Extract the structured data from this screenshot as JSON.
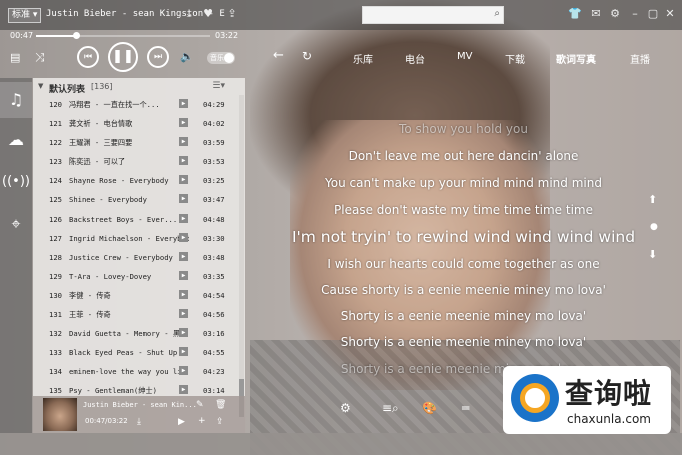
{
  "topbar": {
    "sound_quality": "标准",
    "track_title": "Justin Bieber - sean Kingston - E",
    "search": {
      "value": "",
      "placeholder": ""
    },
    "icons": [
      "download-icon",
      "heart-icon",
      "share-icon",
      "skin-icon",
      "message-icon",
      "gear-icon",
      "minimize-icon",
      "maximize-icon",
      "close-icon"
    ]
  },
  "player": {
    "current_time": "00:47",
    "total_time": "03:22",
    "progress": 0.23,
    "mode_toggle_label": "音乐"
  },
  "leftnav": {
    "items": [
      "music-note-icon",
      "cloud-icon",
      "radio-icon",
      "location-icon"
    ]
  },
  "playlist": {
    "name": "默认列表",
    "count": "[136]",
    "rows": [
      {
        "num": "120",
        "title": "冯翔君 - 一直在找一个...",
        "dur": "04:29"
      },
      {
        "num": "121",
        "title": "龚文祈 - 电台情歌",
        "dur": "04:02"
      },
      {
        "num": "122",
        "title": "王耀渊 - 三要四要",
        "dur": "03:59"
      },
      {
        "num": "123",
        "title": "陈奕迅 - 可以了",
        "dur": "03:53"
      },
      {
        "num": "124",
        "title": "Shayne Rose - Everybody",
        "dur": "03:25"
      },
      {
        "num": "125",
        "title": "Shinee - Everybody",
        "dur": "03:47"
      },
      {
        "num": "126",
        "title": "Backstreet Boys - Ever...",
        "dur": "04:48"
      },
      {
        "num": "127",
        "title": "Ingrid Michaelson - Everybody",
        "dur": "03:30"
      },
      {
        "num": "128",
        "title": "Justice Crew - Everybody",
        "dur": "03:48"
      },
      {
        "num": "129",
        "title": "T-Ara - Lovey-Dovey",
        "dur": "03:35"
      },
      {
        "num": "130",
        "title": "李健 - 传奇",
        "dur": "04:54"
      },
      {
        "num": "131",
        "title": "王菲 - 传奇",
        "dur": "04:56"
      },
      {
        "num": "132",
        "title": "David Guetta - Memory - 黑...",
        "dur": "03:16"
      },
      {
        "num": "133",
        "title": "Black Eyed Peas - Shut Up",
        "dur": "04:55"
      },
      {
        "num": "134",
        "title": "eminem-love the way you lie",
        "dur": "04:23"
      },
      {
        "num": "135",
        "title": "Psy - Gentleman(绅士)",
        "dur": "03:14"
      }
    ]
  },
  "mini": {
    "title": "Justin Bieber - sean Kin...",
    "time": "00:47/03:22"
  },
  "content_nav": {
    "items": [
      "乐库",
      "电台",
      "MV",
      "下载",
      "歌词写真",
      "直播"
    ],
    "active": "歌词写真"
  },
  "lyrics": [
    {
      "text": "To show you hold you",
      "style": "dim"
    },
    {
      "text": "Don't leave me out here dancin' alone",
      "style": "normal"
    },
    {
      "text": "You can't make up your mind mind mind mind",
      "style": "normal"
    },
    {
      "text": "Please don't waste my time time time time",
      "style": "normal"
    },
    {
      "text": "I'm not tryin' to rewind wind wind wind wind",
      "style": "current"
    },
    {
      "text": "I wish our hearts could come together as one",
      "style": "normal"
    },
    {
      "text": "Cause shorty is a eenie meenie miney mo lova'",
      "style": "normal"
    },
    {
      "text": "Shorty is a eenie meenie miney mo lova'",
      "style": "normal"
    },
    {
      "text": "Shorty is a eenie meenie miney mo lova'",
      "style": "normal"
    },
    {
      "text": "Shorty is a eenie meenie miney mo lov...",
      "style": "dim"
    }
  ],
  "watermark": {
    "cn": "查询啦",
    "en": "chaxunla.com"
  }
}
